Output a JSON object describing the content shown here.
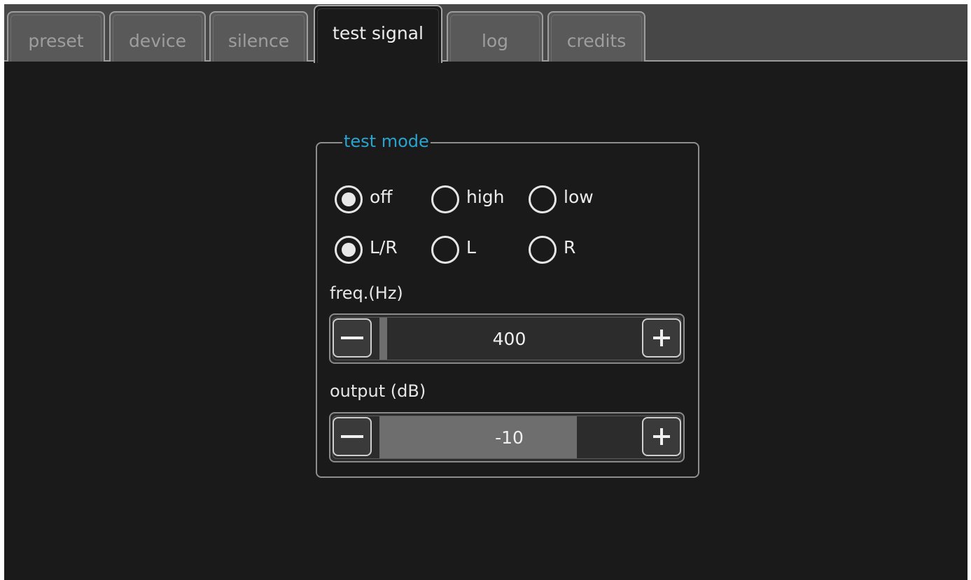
{
  "tabs": [
    {
      "label": "preset",
      "active": false
    },
    {
      "label": "device",
      "active": false
    },
    {
      "label": "silence",
      "active": false
    },
    {
      "label": "test signal",
      "active": true
    },
    {
      "label": "log",
      "active": false
    },
    {
      "label": "credits",
      "active": false
    }
  ],
  "test_mode": {
    "title": "test mode",
    "mode_options": [
      {
        "label": "off",
        "selected": true
      },
      {
        "label": "high",
        "selected": false
      },
      {
        "label": "low",
        "selected": false
      }
    ],
    "channel_options": [
      {
        "label": "L/R",
        "selected": true
      },
      {
        "label": "L",
        "selected": false
      },
      {
        "label": "R",
        "selected": false
      }
    ],
    "freq": {
      "label": "freq.(Hz)",
      "value": "400",
      "level": 0.03,
      "decrement_icon": "minus-icon",
      "increment_icon": "plus-icon"
    },
    "output": {
      "label": "output (dB)",
      "value": "-10",
      "level": 0.76,
      "decrement_icon": "minus-icon",
      "increment_icon": "plus-icon"
    }
  },
  "colors": {
    "background": "#1a1a1a",
    "tab_bar": "#474747",
    "accent_title": "#2ba3cf",
    "slider_fill": "#6e6e6e"
  }
}
